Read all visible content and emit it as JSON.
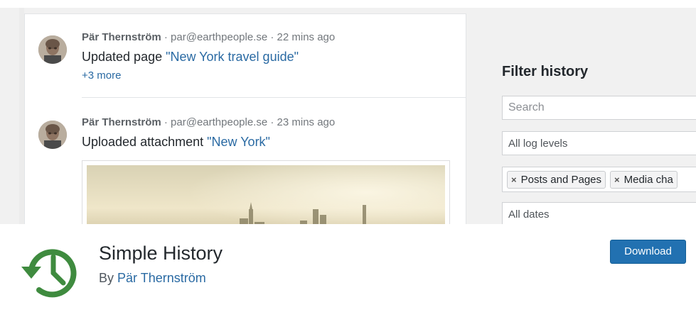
{
  "feed": {
    "entries": [
      {
        "author": "Pär Thernström",
        "meta_rest": " · par@earthpeople.se · 22 mins ago",
        "action_prefix": "Updated page ",
        "action_target": "\"New York travel guide\"",
        "more_label": "+3 more"
      },
      {
        "author": "Pär Thernström",
        "meta_rest": " · par@earthpeople.se · 23 mins ago",
        "action_prefix": "Uploaded attachment ",
        "action_target": "\"New York\""
      }
    ]
  },
  "filter": {
    "title": "Filter history",
    "search_placeholder": "Search",
    "log_levels": "All log levels",
    "tags": [
      "Posts and Pages",
      "Media cha"
    ],
    "dates": "All dates"
  },
  "plugin": {
    "name": "Simple History",
    "by_prefix": "By ",
    "author": "Pär Thernström",
    "download_label": "Download",
    "icon": "history-clock-icon",
    "icon_color": "#3f8b3f",
    "button_color": "#2271b1"
  }
}
